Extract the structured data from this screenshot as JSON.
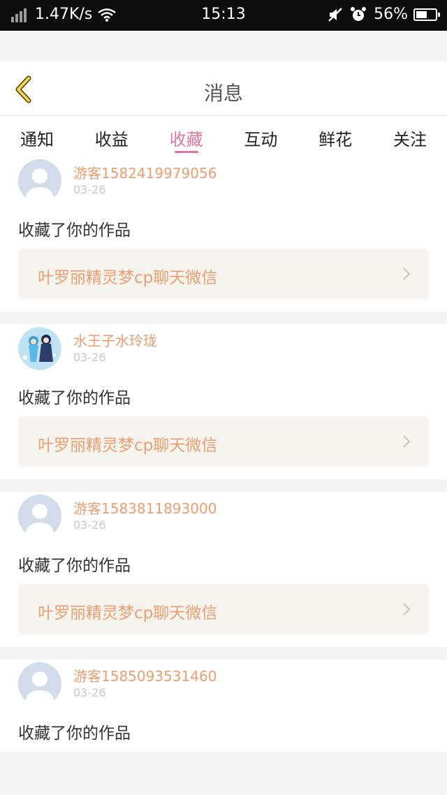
{
  "status_bar": {
    "speed": "1.47K/s",
    "time": "15:13",
    "battery": "56%",
    "battery_level": 0.56,
    "icons": [
      "signal-icon",
      "wifi-icon",
      "mute-icon",
      "alarm-icon",
      "battery-icon"
    ]
  },
  "header": {
    "title": "消息",
    "back_icon": "chevron-left-icon"
  },
  "tabs": [
    {
      "label": "通知",
      "active": false
    },
    {
      "label": "收益",
      "active": false
    },
    {
      "label": "收藏",
      "active": true
    },
    {
      "label": "互动",
      "active": false
    },
    {
      "label": "鲜花",
      "active": false
    },
    {
      "label": "关注",
      "active": false
    }
  ],
  "colors": {
    "accent": "#e2779c",
    "name": "#ee9e70",
    "date": "#c8c8c8",
    "work_bg": "#f5f4ee"
  },
  "items": [
    {
      "name": "游客1582419979056",
      "date": "03-26",
      "action": "收藏了你的作品",
      "work": "叶罗丽精灵梦cp聊天微信",
      "avatar": "default-avatar"
    },
    {
      "name": "水王子水玲珑",
      "date": "03-26",
      "action": "收藏了你的作品",
      "work": "叶罗丽精灵梦cp聊天微信",
      "avatar": "anime-avatar"
    },
    {
      "name": "游客1583811893000",
      "date": "03-26",
      "action": "收藏了你的作品",
      "work": "叶罗丽精灵梦cp聊天微信",
      "avatar": "default-avatar"
    },
    {
      "name": "游客1585093531460",
      "date": "03-26",
      "action": "收藏了你的作品",
      "work": "",
      "avatar": "default-avatar"
    }
  ]
}
